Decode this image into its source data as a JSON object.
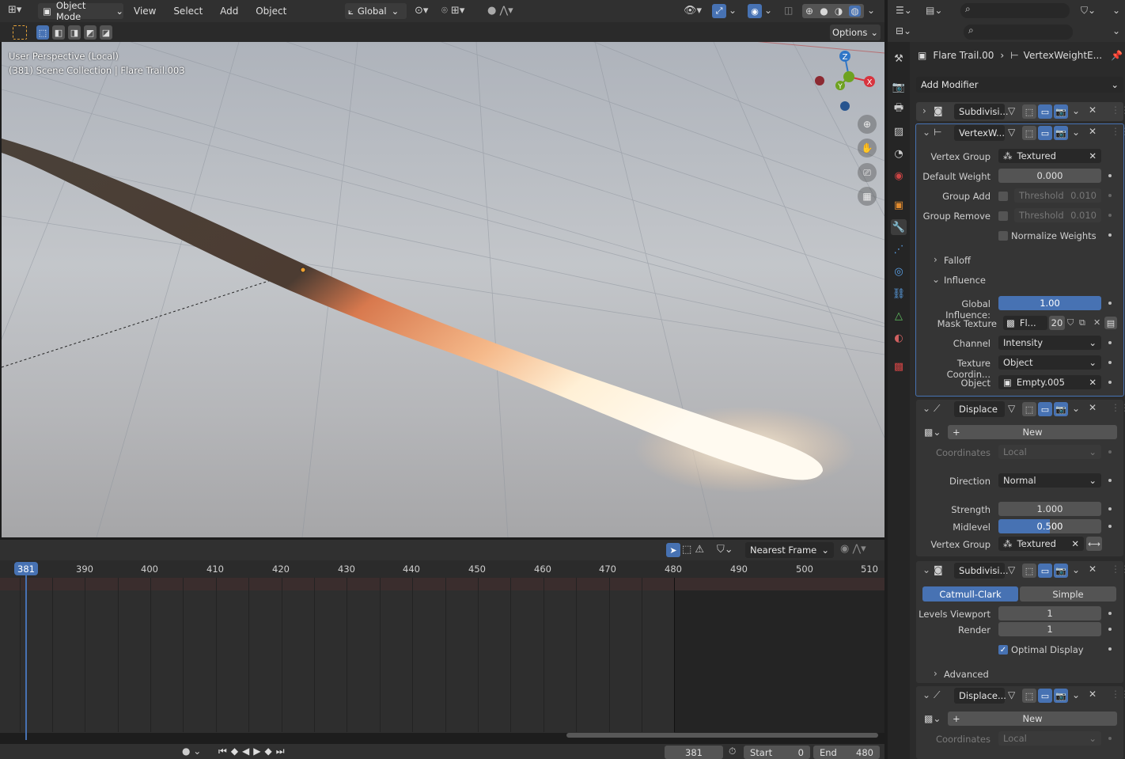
{
  "viewport_header": {
    "mode": "Object Mode",
    "menus": [
      "View",
      "Select",
      "Add",
      "Object"
    ],
    "orientation": "Global",
    "options": "Options"
  },
  "viewport": {
    "line1": "User Perspective (Local)",
    "line2": "(381) Scene Collection | Flare Trail.003",
    "gizmo": {
      "z": "Z",
      "x": "X",
      "y": "Y"
    }
  },
  "timeline": {
    "interpolation": "Nearest Frame",
    "current_frame": "381",
    "ticks": [
      "390",
      "400",
      "410",
      "420",
      "430",
      "440",
      "450",
      "460",
      "470",
      "480",
      "490",
      "500",
      "510"
    ],
    "frame_field": "381",
    "start_label": "Start",
    "start": "0",
    "end_label": "End",
    "end": "480"
  },
  "properties": {
    "breadcrumb_object": "Flare Trail.00",
    "breadcrumb_modifier": "VertexWeightE...",
    "add_modifier": "Add Modifier",
    "mod1": {
      "name": "Subdivisi..."
    },
    "mod2": {
      "name": "VertexW...",
      "vertex_group_label": "Vertex Group",
      "vertex_group": "Textured",
      "default_weight_label": "Default Weight",
      "default_weight": "0.000",
      "group_add_label": "Group Add",
      "threshold_label": "Threshold",
      "threshold1": "0.010",
      "group_remove_label": "Group Remove",
      "threshold2": "0.010",
      "normalize_label": "Normalize Weights",
      "falloff": "Falloff",
      "influence": "Influence",
      "global_influence_label": "Global Influence:",
      "global_influence": "1.00",
      "mask_texture_label": "Mask Texture",
      "mask_texture": "Fl...",
      "mask_users": "20",
      "channel_label": "Channel",
      "channel": "Intensity",
      "texcoord_label": "Texture Coordin...",
      "texcoord": "Object",
      "object_label": "Object",
      "object": "Empty.005"
    },
    "mod3": {
      "name": "Displace",
      "new": "New",
      "coordinates_label": "Coordinates",
      "coordinates": "Local",
      "direction_label": "Direction",
      "direction": "Normal",
      "strength_label": "Strength",
      "strength": "1.000",
      "midlevel_label": "Midlevel",
      "midlevel": "0.500",
      "vertex_group_label": "Vertex Group",
      "vertex_group": "Textured"
    },
    "mod4": {
      "name": "Subdivisi...",
      "catmull": "Catmull-Clark",
      "simple": "Simple",
      "levels_label": "Levels Viewport",
      "levels": "1",
      "render_label": "Render",
      "render": "1",
      "optimal_label": "Optimal Display",
      "advanced": "Advanced"
    },
    "mod5": {
      "name": "Displace...",
      "new": "New",
      "coordinates_label": "Coordinates",
      "coordinates": "Local"
    }
  },
  "colors": {
    "accent": "#4772b3",
    "x_axis": "#d8343e",
    "y_axis": "#6ea220",
    "z_axis": "#2f76c7"
  }
}
